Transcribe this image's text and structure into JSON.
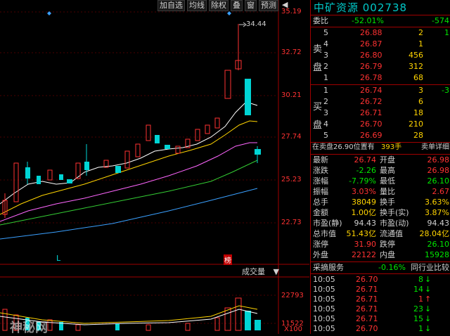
{
  "toolbar": [
    "加自选",
    "均线",
    "除权",
    "叠",
    "窗",
    "预测"
  ],
  "toolbar_arrow": "◀",
  "price_axis": [
    "35.19",
    "32.72",
    "30.21",
    "27.74",
    "25.23",
    "22.73"
  ],
  "volume_axis": [
    "22793",
    "11522",
    "X100"
  ],
  "annotations": {
    "high_marker": "34.44",
    "L_marker": "L",
    "bang_badge": "榜",
    "volume_selector": "成交量"
  },
  "title": "中矿资源 002738",
  "weibi": {
    "label": "委比",
    "pct": "-52.01%",
    "diff": "-574"
  },
  "sell_label": [
    "卖",
    "盘"
  ],
  "buy_label": [
    "买",
    "盘"
  ],
  "sell_rows": [
    {
      "level": "5",
      "price": "26.88",
      "vol": "2",
      "chg": "1"
    },
    {
      "level": "4",
      "price": "26.87",
      "vol": "1",
      "chg": ""
    },
    {
      "level": "3",
      "price": "26.80",
      "vol": "456",
      "chg": ""
    },
    {
      "level": "2",
      "price": "26.79",
      "vol": "312",
      "chg": ""
    },
    {
      "level": "1",
      "price": "26.78",
      "vol": "68",
      "chg": ""
    }
  ],
  "buy_rows": [
    {
      "level": "1",
      "price": "26.74",
      "vol": "3",
      "chg": "-3"
    },
    {
      "level": "2",
      "price": "26.72",
      "vol": "6",
      "chg": ""
    },
    {
      "level": "3",
      "price": "26.71",
      "vol": "18",
      "chg": ""
    },
    {
      "level": "4",
      "price": "26.70",
      "vol": "210",
      "chg": ""
    },
    {
      "level": "5",
      "price": "26.69",
      "vol": "28",
      "chg": ""
    }
  ],
  "position_line": {
    "text": "在卖盘26.90位置有",
    "qty": "393手",
    "detail": "卖单详细"
  },
  "stats": [
    [
      "最新",
      "26.74",
      "开盘",
      "26.98"
    ],
    [
      "涨跌",
      "-2.26",
      "最高",
      "26.98"
    ],
    [
      "涨幅",
      "-7.79%",
      "最低",
      "26.10"
    ],
    [
      "振幅",
      "3.03%",
      "量比",
      "2.67"
    ],
    [
      "总手",
      "38049",
      "换手",
      "3.63%"
    ],
    [
      "金额",
      "1.00亿",
      "换手(实)",
      "3.87%"
    ],
    [
      "市盈(静)",
      "94.43",
      "市盈(动)",
      "94.43"
    ],
    [
      "总市值",
      "51.43亿",
      "流通值",
      "28.04亿"
    ],
    [
      "涨停",
      "31.90",
      "跌停",
      "26.10"
    ],
    [
      "外盘",
      "22122",
      "内盘",
      "15928"
    ]
  ],
  "tabs": {
    "left": "采摘服务",
    "pct": "-0.16%",
    "right": "同行业比较"
  },
  "ticks": [
    [
      "10:05",
      "26.70",
      "8",
      "down"
    ],
    [
      "10:05",
      "26.71",
      "14",
      "down"
    ],
    [
      "10:05",
      "26.71",
      "1",
      "up"
    ],
    [
      "10:05",
      "26.71",
      "23",
      "down"
    ],
    [
      "10:05",
      "26.71",
      "15",
      "down"
    ],
    [
      "10:05",
      "26.70",
      "1",
      "down"
    ]
  ],
  "watermark": "神秘网",
  "colors": {
    "up": "#ff3232",
    "down": "#00e600",
    "accent": "#00c8c8",
    "grid": "#a00000"
  }
}
